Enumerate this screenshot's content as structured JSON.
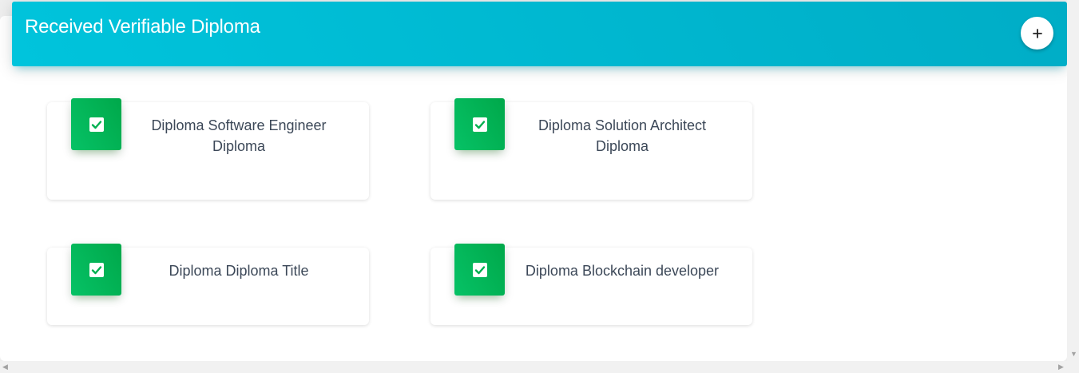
{
  "header": {
    "title": "Received Verifiable Diploma",
    "add_label": "+"
  },
  "diplomas": [
    {
      "title": "Diploma Software Engineer Diploma"
    },
    {
      "title": "Diploma Solution Architect Diploma"
    },
    {
      "title": "Diploma Diploma Title"
    },
    {
      "title": "Diploma Blockchain developer"
    }
  ],
  "colors": {
    "header_accent": "#00bcd4",
    "icon_accent": "#00b050",
    "text": "#3c4858"
  },
  "icons": {
    "diploma": "checkbox-checked-icon",
    "add": "plus-icon"
  }
}
